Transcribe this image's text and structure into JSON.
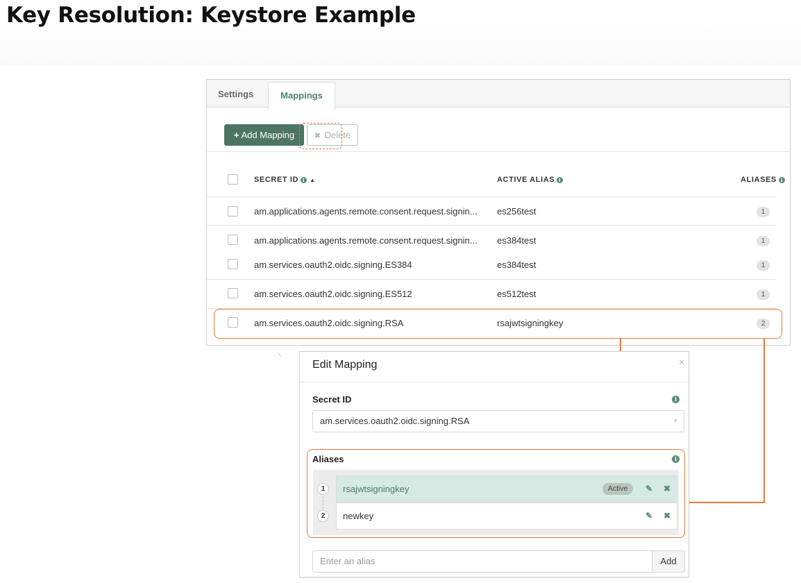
{
  "slide": {
    "title": "Key Resolution: Keystore Example"
  },
  "tabs": [
    {
      "label": "Settings"
    },
    {
      "label": "Mappings"
    }
  ],
  "toolbar": {
    "add_label": "Add Mapping",
    "add_icon": "plus-icon",
    "delete_label": "Delete",
    "delete_icon": "x-icon"
  },
  "table": {
    "headers": {
      "secret_id": "SECRET ID",
      "active_alias": "ACTIVE ALIAS",
      "aliases": "ALIASES"
    },
    "sort_indicator": "▲",
    "rows": [
      {
        "secret_id": "am.applications.agents.remote.consent.request.signin...",
        "active_alias": "es256test",
        "aliases": "1"
      },
      {
        "secret_id": "am.applications.agents.remote.consent.request.signin...",
        "active_alias": "es384test",
        "aliases": "1"
      },
      {
        "secret_id": "am.services.oauth2.oidc.signing.ES384",
        "active_alias": "es384test",
        "aliases": "1"
      },
      {
        "secret_id": "am.services.oauth2.oidc.signing.ES512",
        "active_alias": "es512test",
        "aliases": "1"
      },
      {
        "secret_id": "am.services.oauth2.oidc.signing.RSA",
        "active_alias": "rsajwtsigningkey",
        "aliases": "2"
      }
    ]
  },
  "modal": {
    "title": "Edit Mapping",
    "close": "×",
    "secret_id_label": "Secret ID",
    "secret_id_value": "am.services.oauth2.oidc.signing.RSA",
    "aliases_label": "Aliases",
    "aliases": [
      {
        "index": "1",
        "name": "rsajwtsigningkey",
        "status": "Active"
      },
      {
        "index": "2",
        "name": "newkey",
        "status": ""
      }
    ],
    "alias_placeholder": "Enter an alias",
    "add_button": "Add"
  },
  "colors": {
    "accent": "#4d7566",
    "highlight": "#e07a3c",
    "active_row": "#d4eae2"
  }
}
